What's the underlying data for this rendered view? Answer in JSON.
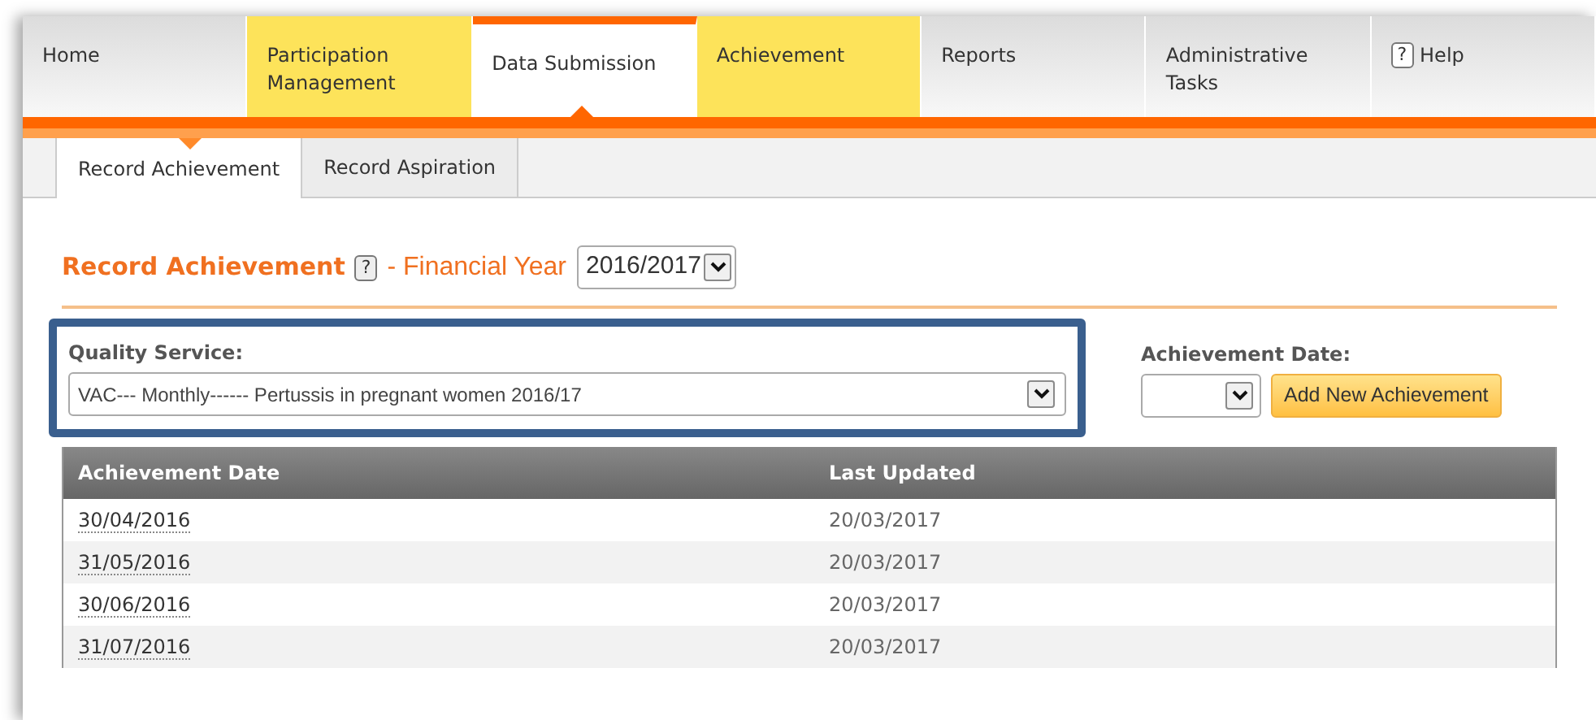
{
  "nav_tabs": [
    {
      "label": "Home",
      "selected": false,
      "highlighted": false
    },
    {
      "label": "Participation Management",
      "selected": false,
      "highlighted": true
    },
    {
      "label": "Data Submission",
      "selected": true,
      "highlighted": false
    },
    {
      "label": "Achievement",
      "selected": false,
      "highlighted": true
    },
    {
      "label": "Reports",
      "selected": false,
      "highlighted": false
    },
    {
      "label": "Administrative Tasks",
      "selected": false,
      "highlighted": false
    },
    {
      "label": "Help",
      "selected": false,
      "highlighted": false,
      "icon_text": "?"
    }
  ],
  "sub_tabs": [
    {
      "label": "Record Achievement",
      "selected": true
    },
    {
      "label": "Record Aspiration",
      "selected": false
    }
  ],
  "heading": {
    "title": "Record Achievement",
    "help_text": "?",
    "subtitle": "- Financial Year",
    "year_select": "2016/2017"
  },
  "quality_service": {
    "label": "Quality Service:",
    "value": "VAC--- Monthly------ Pertussis in pregnant women 2016/17",
    "highlighted": true
  },
  "achievement_date": {
    "label": "Achievement Date:",
    "button": "Add New Achievement"
  },
  "table": {
    "columns": [
      "Achievement Date",
      "Last Updated"
    ],
    "rows": [
      [
        "30/04/2016",
        "20/03/2017"
      ],
      [
        "31/05/2016",
        "20/03/2017"
      ],
      [
        "30/06/2016",
        "20/03/2017"
      ],
      [
        "31/07/2016",
        "20/03/2017"
      ]
    ]
  }
}
